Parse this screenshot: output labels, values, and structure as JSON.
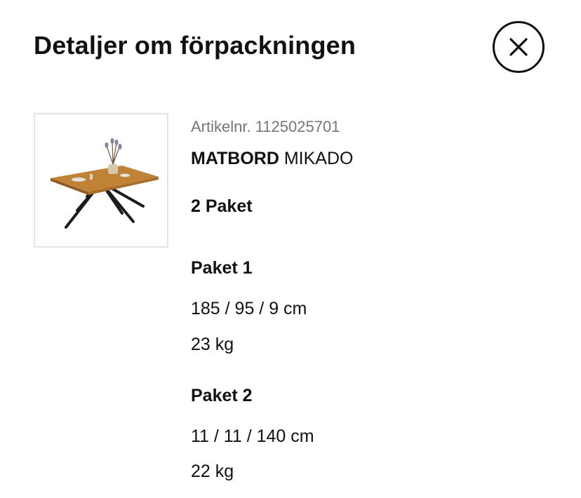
{
  "header": {
    "title": "Detaljer om förpackningen",
    "close_icon": "close-icon"
  },
  "product": {
    "image_icon": "table-product-image",
    "article_number_text": "Artikelnr. 1125025701",
    "name_bold": "MATBORD",
    "name_rest": " MIKADO",
    "package_count": "2 Paket"
  },
  "packages": [
    {
      "title": "Paket 1",
      "dimensions": "185 / 95 / 9 cm",
      "weight": "23 kg"
    },
    {
      "title": "Paket 2",
      "dimensions": "11 / 11 / 140 cm",
      "weight": "22 kg"
    }
  ]
}
